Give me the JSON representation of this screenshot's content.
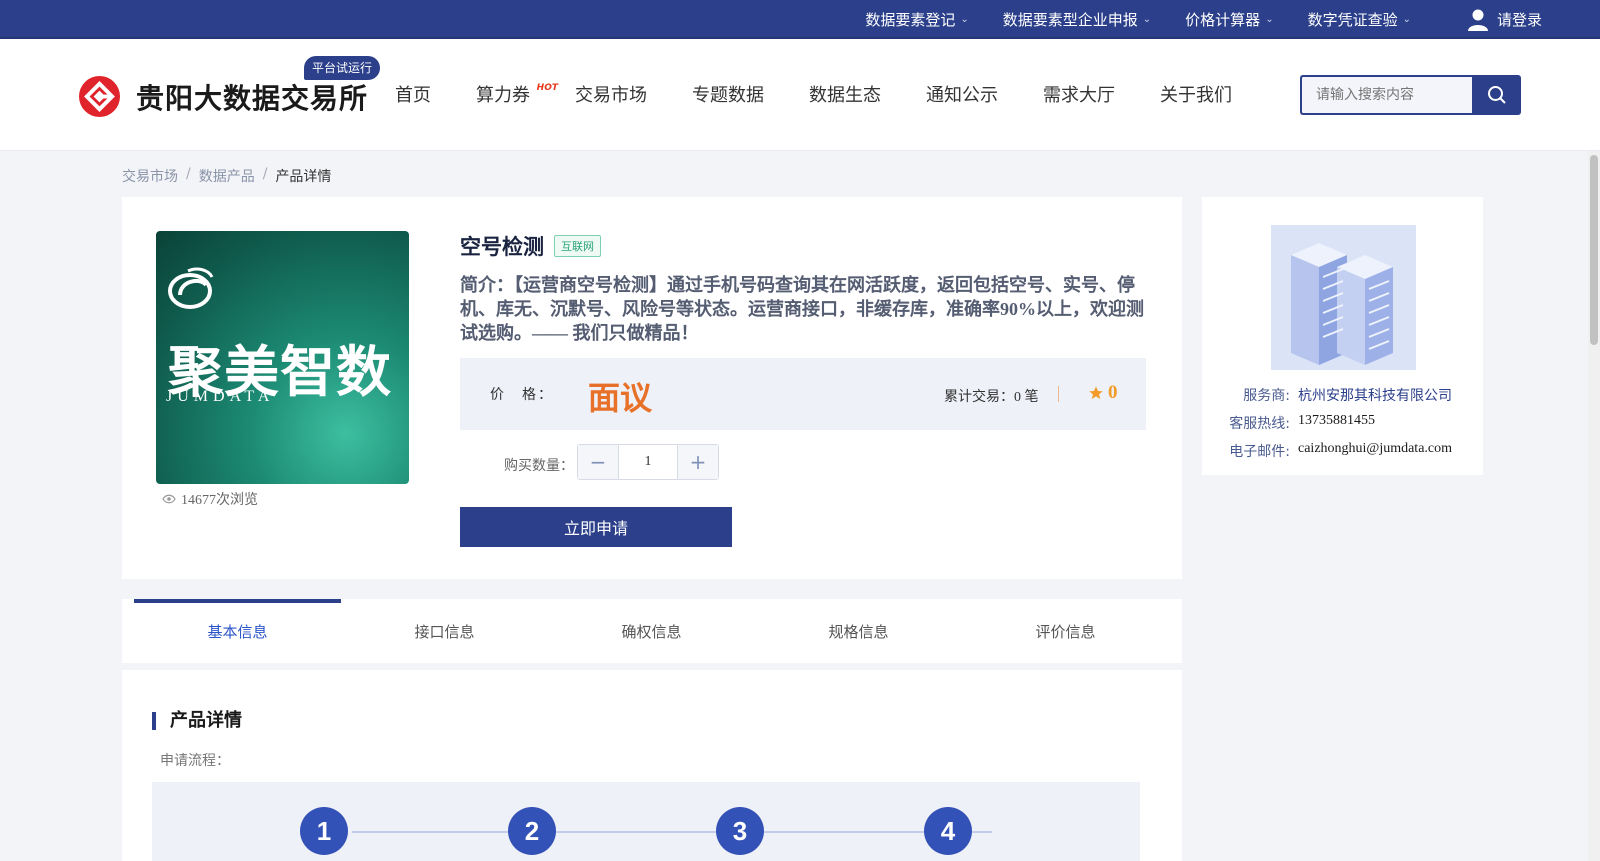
{
  "topbar": {
    "links": [
      {
        "label": "数据要素登记"
      },
      {
        "label": "数据要素型企业申报"
      },
      {
        "label": "价格计算器"
      },
      {
        "label": "数字凭证查验"
      }
    ],
    "login_label": "请登录"
  },
  "header": {
    "logo_text": "贵阳大数据交易所",
    "beta_badge": "平台试运行",
    "nav": [
      {
        "label": "首页"
      },
      {
        "label": "算力券",
        "badge": "HOT"
      },
      {
        "label": "交易市场"
      },
      {
        "label": "专题数据"
      },
      {
        "label": "数据生态"
      },
      {
        "label": "通知公示"
      },
      {
        "label": "需求大厅"
      },
      {
        "label": "关于我们"
      }
    ],
    "search_placeholder": "请输入搜索内容"
  },
  "breadcrumb": {
    "items": [
      "交易市场",
      "数据产品"
    ],
    "current": "产品详情"
  },
  "product": {
    "image_brand": "聚美智数",
    "image_brand_en": "JUMDATA",
    "views": "14677次浏览",
    "title": "空号检测",
    "tag": "互联网",
    "intro": "简介：【运营商空号检测】通过手机号码查询其在网活跃度，返回包括空号、实号、停机、库无、沉默号、风险号等状态。运营商接口，非缓存库，准确率90%以上，欢迎测试选购。—— 我们只做精品！",
    "price_label": "价　格：",
    "price_value": "面议",
    "tx_count": "累计交易：0 笔",
    "rating": "0",
    "qty_label": "购买数量：",
    "qty_value": "1",
    "apply_label": "立即申请"
  },
  "provider": {
    "rows": [
      {
        "key": "服务商:",
        "value": "杭州安那其科技有限公司"
      },
      {
        "key": "客服热线:",
        "value": "13735881455"
      },
      {
        "key": "电子邮件:",
        "value": "caizhonghui@jumdata.com"
      }
    ]
  },
  "tabs": [
    {
      "label": "基本信息",
      "active": true
    },
    {
      "label": "接口信息"
    },
    {
      "label": "确权信息"
    },
    {
      "label": "规格信息"
    },
    {
      "label": "评价信息"
    }
  ],
  "detail": {
    "title": "产品详情",
    "flow_label": "申请流程：",
    "steps": [
      "1",
      "2",
      "3",
      "4"
    ]
  },
  "colors": {
    "primary": "#2b3f8a",
    "price": "#e8712a",
    "rating": "#f29b29",
    "tag": "#2aa37a"
  }
}
